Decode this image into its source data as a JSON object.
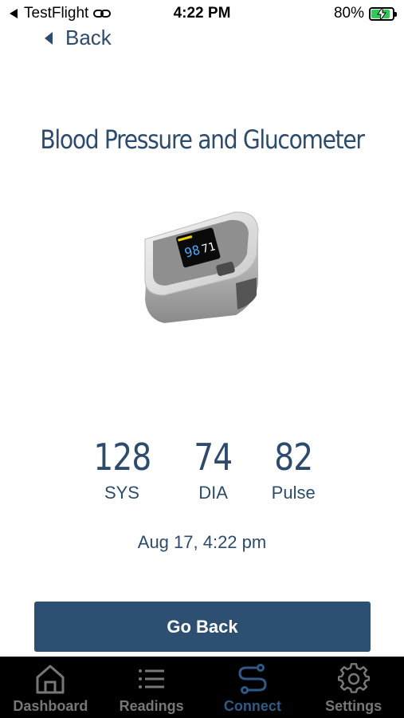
{
  "status_bar": {
    "app": "TestFlight",
    "time": "4:22 PM",
    "battery": "80%"
  },
  "nav": {
    "back_label": "Back"
  },
  "page": {
    "title": "Blood Pressure and Glucometer"
  },
  "device_screen": {
    "spo2": "98",
    "pulse": "71"
  },
  "readings": [
    {
      "value": "128",
      "label": "SYS"
    },
    {
      "value": "74",
      "label": "DIA"
    },
    {
      "value": "82",
      "label": "Pulse"
    }
  ],
  "timestamp": "Aug 17, 4:22 pm",
  "actions": {
    "go_back_label": "Go Back"
  },
  "tabbar": {
    "active_color": "#2f5a86",
    "items": [
      {
        "label": "Dashboard",
        "icon": "home-icon"
      },
      {
        "label": "Readings",
        "icon": "list-icon"
      },
      {
        "label": "Connect",
        "icon": "connect-icon"
      },
      {
        "label": "Settings",
        "icon": "gear-icon"
      }
    ]
  }
}
